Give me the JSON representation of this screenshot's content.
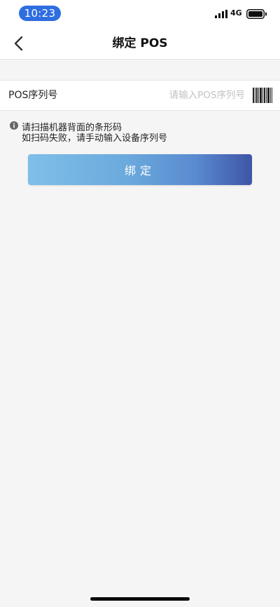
{
  "status_bar": {
    "time": "10:23",
    "network": "4G",
    "icons": [
      "signal-icon",
      "battery-icon"
    ]
  },
  "nav": {
    "title": "绑定 POS",
    "back_icon": "chevron-left-icon"
  },
  "form": {
    "serial_label": "POS序列号",
    "serial_placeholder": "请输入POS序列号",
    "serial_value": "",
    "scan_icon": "barcode-icon"
  },
  "hint": {
    "icon": "info-icon",
    "line1": "请扫描机器背面的条形码",
    "line2": "如扫码失败，请手动输入设备序列号"
  },
  "actions": {
    "bind_label": "绑定"
  },
  "colors": {
    "status_pill": "#2f6ee0",
    "button_gradient_start": "#7fbfe8",
    "button_gradient_end": "#3e55a6",
    "background": "#f5f5f5"
  }
}
